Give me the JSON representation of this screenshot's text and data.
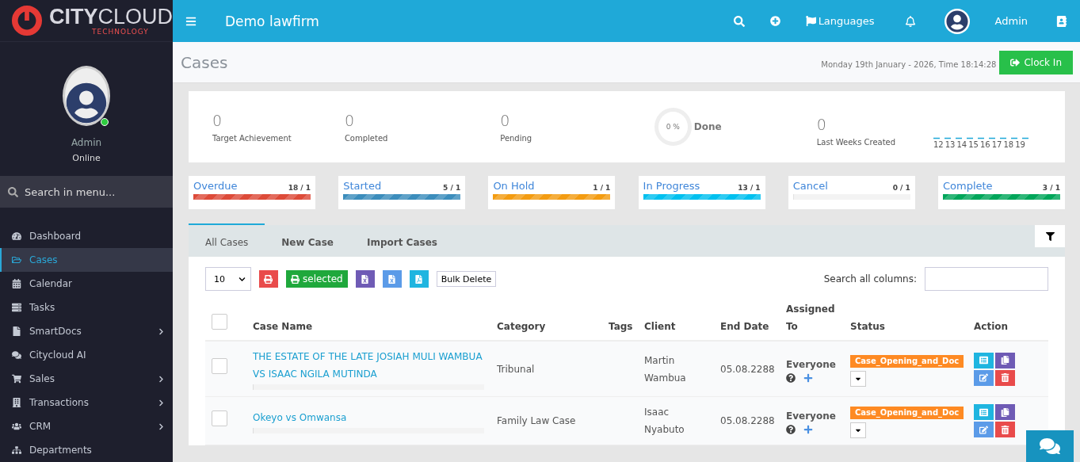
{
  "brand": {
    "name": "**CITY**CLOUD",
    "tagline": "TECHNOLOGY"
  },
  "profile": {
    "name": "Admin",
    "status": "Online",
    "online": true
  },
  "sidebar": {
    "search_placeholder": "Search in menu...",
    "items": [
      {
        "label": "Dashboard",
        "selected": false,
        "has_submenu": false
      },
      {
        "label": "Cases",
        "selected": true,
        "has_submenu": false
      },
      {
        "label": "Calendar",
        "selected": false,
        "has_submenu": false
      },
      {
        "label": "Tasks",
        "selected": false,
        "has_submenu": false
      },
      {
        "label": "SmartDocs",
        "selected": false,
        "has_submenu": true
      },
      {
        "label": "Citycloud AI",
        "selected": false,
        "has_submenu": false
      },
      {
        "label": "Sales",
        "selected": false,
        "has_submenu": true
      },
      {
        "label": "Transactions",
        "selected": false,
        "has_submenu": true
      },
      {
        "label": "CRM",
        "selected": false,
        "has_submenu": true
      },
      {
        "label": "Departments",
        "selected": false,
        "has_submenu": false
      }
    ]
  },
  "topbar": {
    "title": "Demo lawfirm",
    "languages": "Languages",
    "user": "Admin"
  },
  "page": {
    "title": "Cases",
    "date": "Monday 19th January - 2026,",
    "time_label": "Time",
    "time": "18:14:28",
    "clock_in": "Clock In"
  },
  "stats": [
    {
      "value": "0",
      "label": "Target Achievement"
    },
    {
      "value": "0",
      "label": "Completed"
    },
    {
      "value": "0",
      "label": "Pending"
    }
  ],
  "done": {
    "value": "0 %",
    "label": "Done"
  },
  "last_weeks": {
    "value": "0",
    "label": "Last Weeks Created",
    "days": [
      "12",
      "13",
      "14",
      "15",
      "16",
      "17",
      "18",
      "19"
    ]
  },
  "status_cards": [
    {
      "label": "Overdue",
      "count": "18 / 1",
      "level": 1,
      "color": "#dd4b39"
    },
    {
      "label": "Started",
      "count": "5 / 1",
      "level": 1,
      "color": "#3c8dbc"
    },
    {
      "label": "On Hold",
      "count": "1 / 1",
      "level": 1,
      "color": "#f39c12"
    },
    {
      "label": "In Progress",
      "count": "13 / 1",
      "level": 1,
      "color": "#00c0ef"
    },
    {
      "label": "Cancel",
      "count": "0 / 1",
      "level": 0
    },
    {
      "label": "Complete",
      "count": "3 / 1",
      "level": 1,
      "color": "#00a65a"
    }
  ],
  "tabs": [
    {
      "label": "All Cases",
      "selected": true
    },
    {
      "label": "New Case",
      "selected": false
    },
    {
      "label": "Import Cases",
      "selected": false
    }
  ],
  "toolbar": {
    "page_size": "10",
    "print_selected": "selected",
    "bulk_delete": "Bulk Delete",
    "search_label": "Search all columns:"
  },
  "table": {
    "all_checked": false,
    "columns": [
      "Case Name",
      "Category",
      "Tags",
      "Client",
      "End Date",
      "Assigned To",
      "Status",
      "Action"
    ],
    "rows": [
      {
        "checked": false,
        "case_name": "THE ESTATE OF THE LATE JOSIAH MULI WAMBUA VS ISAAC NGILA MUTINDA",
        "level": 0,
        "category": "Tribunal",
        "client": "Martin Wambua",
        "end_date": "05.08.2288",
        "assigned": "Everyone",
        "status": "Case_Opening_and_Doc"
      },
      {
        "checked": false,
        "case_name": "Okeyo vs Omwansa",
        "level": 0,
        "category": "Family Law Case",
        "client": "Isaac Nyabuto",
        "end_date": "05.08.2288",
        "assigned": "Everyone",
        "status": "Case_Opening_and_Doc"
      }
    ]
  }
}
